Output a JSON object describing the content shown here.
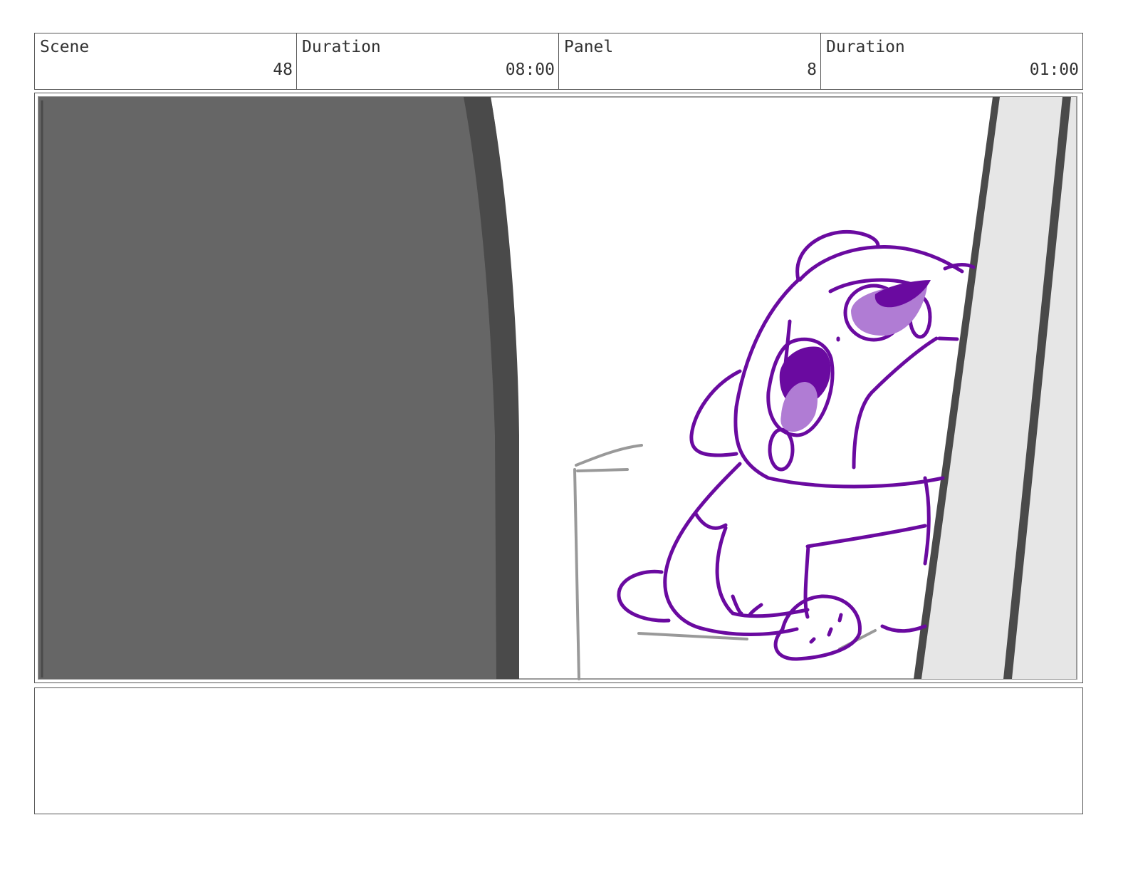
{
  "header": {
    "scene_label": "Scene",
    "scene_value": "48",
    "scene_duration_label": "Duration",
    "scene_duration_value": "08:00",
    "panel_label": "Panel",
    "panel_value": "8",
    "panel_duration_label": "Duration",
    "panel_duration_value": "01:00"
  },
  "notes": {
    "text": ""
  },
  "colors": {
    "border": "#555555",
    "text": "#333333",
    "foreground_dark": "#666666",
    "foreground_edge": "#4a4a4a",
    "character_line": "#6a0aa0",
    "eye_dark": "#6a0aa0",
    "eye_light": "#b07cd4",
    "door_fill": "#e6e6e6",
    "door_edge": "#4a4a4a",
    "sketch_gray": "#999999"
  },
  "icons": [
    "storyboard-panel-drawing"
  ]
}
